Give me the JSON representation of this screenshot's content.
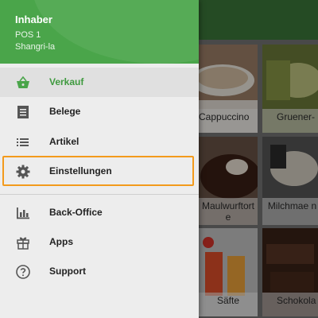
{
  "drawer": {
    "owner": "Inhaber",
    "pos": "POS 1",
    "store": "Shangri-la",
    "primary_items": [
      {
        "label": "Verkauf",
        "icon": "basket-icon",
        "active": true
      },
      {
        "label": "Belege",
        "icon": "receipt-icon"
      },
      {
        "label": "Artikel",
        "icon": "list-icon"
      },
      {
        "label": "Einstellungen",
        "icon": "gear-icon",
        "highlighted": true
      }
    ],
    "secondary_items": [
      {
        "label": "Back-Office",
        "icon": "bar-chart-icon"
      },
      {
        "label": "Apps",
        "icon": "apps-icon"
      },
      {
        "label": "Support",
        "icon": "help-icon"
      }
    ]
  },
  "products": [
    {
      "caption": "Cappuccino"
    },
    {
      "caption": "Gruener-"
    },
    {
      "caption": "Maulwurftort e"
    },
    {
      "caption": "Milchmae n"
    },
    {
      "caption": "Säfte"
    },
    {
      "caption": "Schokola"
    }
  ],
  "colors": {
    "primary": "#4aa54a",
    "accent": "#3f9a3f",
    "highlight": "#f39a1c"
  }
}
